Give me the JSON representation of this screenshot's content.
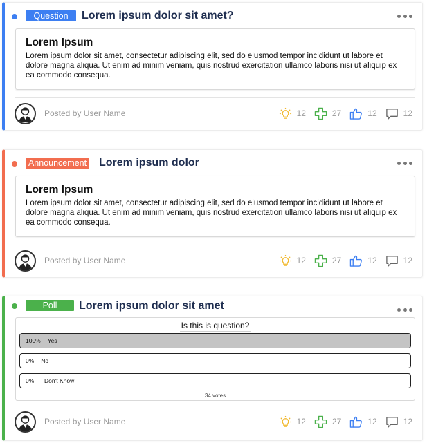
{
  "colors": {
    "question": "#3d7ff2",
    "announcement": "#f26d4f",
    "poll": "#4bb14b"
  },
  "posts": [
    {
      "badge": "Question",
      "title": "Lorem ipsum dolor sit amet?",
      "body_title": "Lorem Ipsum",
      "body_text": "Lorem ipsum dolor sit amet, consectetur adipiscing elit, sed do eiusmod tempor incididunt ut labore et dolore magna aliqua. Ut enim ad minim veniam, quis nostrud exercitation ullamco laboris nisi ut aliquip ex ea commodo consequa.",
      "posted_by": "Posted by User Name",
      "stats": {
        "ideas": "12",
        "plus": "27",
        "likes": "12",
        "comments": "12"
      }
    },
    {
      "badge": "Announcement",
      "title": "Lorem ipsum dolor",
      "body_title": "Lorem Ipsum",
      "body_text": "Lorem ipsum dolor sit amet, consectetur adipiscing elit, sed do eiusmod tempor incididunt ut labore et dolore magna aliqua. Ut enim ad minim veniam, quis nostrud exercitation ullamco laboris nisi ut aliquip ex ea commodo consequa.",
      "posted_by": "Posted by User Name",
      "stats": {
        "ideas": "12",
        "plus": "27",
        "likes": "12",
        "comments": "12"
      }
    },
    {
      "badge": "Poll",
      "title": "Lorem ipsum dolor sit amet",
      "poll": {
        "question": "Is this is question?",
        "options": [
          {
            "percent_label": "100%",
            "percent": 100,
            "label": "Yes"
          },
          {
            "percent_label": "0%",
            "percent": 0,
            "label": "No"
          },
          {
            "percent_label": "0%",
            "percent": 0,
            "label": "I Don't Know"
          }
        ],
        "votes": "34 votes"
      },
      "posted_by": "Posted by User Name",
      "stats": {
        "ideas": "12",
        "plus": "27",
        "likes": "12",
        "comments": "12"
      }
    }
  ]
}
